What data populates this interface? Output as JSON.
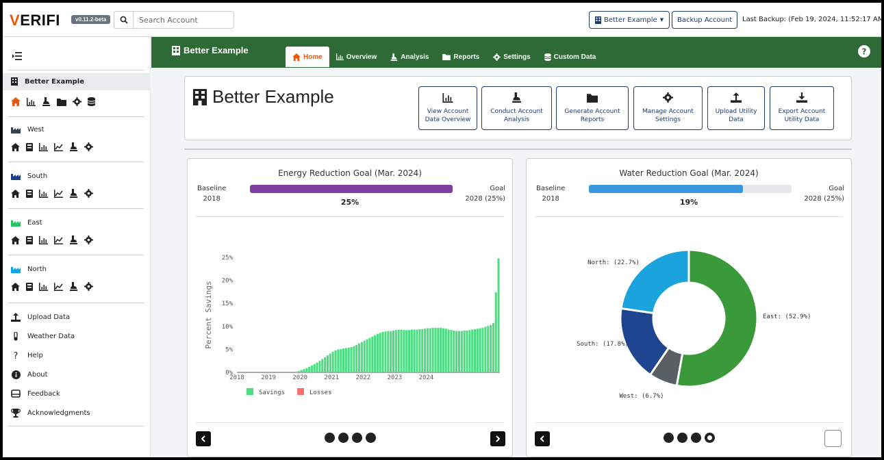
{
  "topbar": {
    "logo_v": "V",
    "logo_rest": "ERIFI",
    "version": "v0.11.2-beta",
    "search_placeholder": "Search Account",
    "account_selector": "Better Example",
    "backup_button": "Backup Account",
    "last_backup": "Last Backup: (Feb 19, 2024, 11:52:17 AM)"
  },
  "sidebar": {
    "account": "Better Example",
    "facilities": [
      {
        "name": "West",
        "color": "#374151"
      },
      {
        "name": "South",
        "color": "#1e3a8a"
      },
      {
        "name": "East",
        "color": "#22c55e"
      },
      {
        "name": "North",
        "color": "#0ea5e9"
      }
    ],
    "links": [
      {
        "label": "Upload Data",
        "icon": "upload-icon"
      },
      {
        "label": "Weather Data",
        "icon": "thermometer-icon"
      },
      {
        "label": "Help",
        "icon": "question-icon"
      },
      {
        "label": "About",
        "icon": "info-icon"
      },
      {
        "label": "Feedback",
        "icon": "inbox-icon"
      },
      {
        "label": "Acknowledgments",
        "icon": "trophy-icon"
      }
    ]
  },
  "header": {
    "title": "Better Example",
    "tabs": [
      "Home",
      "Overview",
      "Analysis",
      "Reports",
      "Settings",
      "Custom Data"
    ]
  },
  "head_card": {
    "title": "Better Example",
    "buttons": [
      "View Account\nData Overview",
      "Conduct Account\nAnalysis",
      "Generate Account\nReports",
      "Manage Account\nSettings",
      "Upload Utility\nData",
      "Export Account\nUtility Data"
    ]
  },
  "energy": {
    "title": "Energy Reduction Goal (Mar. 2024)",
    "baseline_label": "Baseline",
    "baseline_year": "2018",
    "goal_label": "Goal",
    "goal_year": "2028 (25%)",
    "progress_text": "25%",
    "progress": 1.0,
    "color": "#7e3fa0"
  },
  "water": {
    "title": "Water Reduction Goal (Mar. 2024)",
    "baseline_label": "Baseline",
    "baseline_year": "2018",
    "goal_label": "Goal",
    "goal_year": "2028 (25%)",
    "progress_text": "19%",
    "progress": 0.76,
    "color": "#3a97dc"
  },
  "chart_data": [
    {
      "type": "bar",
      "ylabel": "Percent Savings",
      "xlabel": "",
      "ylim": [
        0,
        25
      ],
      "y_ticks": [
        "0%",
        "5%",
        "10%",
        "15%",
        "20%",
        "25%"
      ],
      "x_ticks": [
        "2018",
        "2019",
        "2020",
        "2021",
        "2022",
        "2023",
        "2024"
      ],
      "legend": [
        "Savings",
        "Losses"
      ],
      "colors": {
        "Savings": "#4ade80",
        "Losses": "#f87171"
      },
      "x_start": "2018-01",
      "values": [
        0,
        0,
        0,
        0,
        0,
        0,
        0,
        0,
        0,
        0,
        0,
        0,
        0,
        0,
        0,
        0,
        0,
        0,
        0,
        0,
        0,
        0,
        0,
        0.3,
        0.5,
        0.7,
        0.9,
        1.2,
        1.5,
        1.8,
        2.1,
        2.5,
        2.9,
        3.3,
        3.7,
        4.1,
        4.5,
        4.8,
        5.0,
        5.1,
        5.2,
        5.3,
        5.4,
        5.5,
        5.7,
        6.0,
        6.3,
        6.6,
        6.9,
        7.2,
        7.5,
        7.8,
        8.1,
        8.4,
        8.6,
        8.8,
        8.9,
        9.0,
        9.0,
        9.1,
        9.2,
        9.3,
        9.3,
        9.2,
        9.2,
        9.2,
        9.3,
        9.3,
        9.3,
        9.4,
        9.4,
        9.5,
        9.6,
        9.6,
        9.7,
        9.7,
        9.7,
        9.7,
        9.6,
        9.5,
        9.3,
        9.2,
        9.1,
        9.0,
        9.0,
        9.0,
        9.1,
        9.1,
        9.2,
        9.3,
        9.4,
        9.5,
        9.6,
        9.7,
        9.9,
        10.1,
        10.3,
        10.7,
        17.4,
        24.8
      ]
    },
    {
      "type": "pie",
      "labels": [
        "East: (52.9%)",
        "West: (6.7%)",
        "South: (17.8%)",
        "North: (22.7%)"
      ],
      "categories": [
        "East",
        "West",
        "South",
        "North"
      ],
      "values": [
        52.9,
        6.7,
        17.8,
        22.7
      ],
      "colors": [
        "#3a9a3a",
        "#5a5f63",
        "#1f4591",
        "#1aa3dd"
      ]
    }
  ]
}
